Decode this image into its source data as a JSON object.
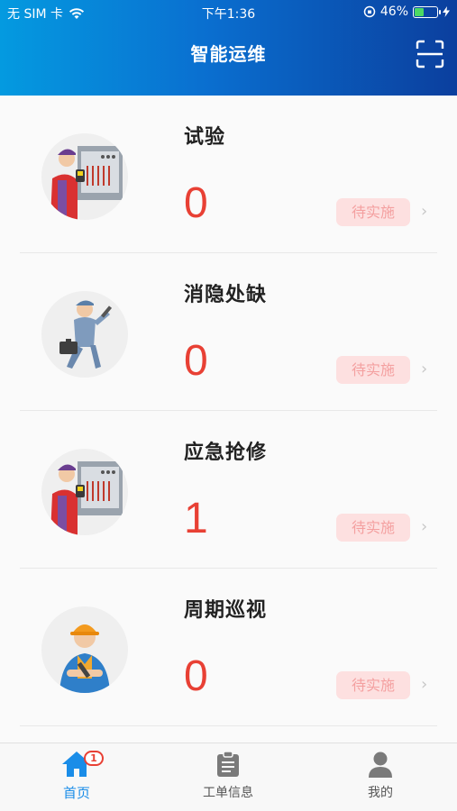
{
  "status_bar": {
    "carrier": "无 SIM 卡",
    "time": "下午1:36",
    "battery_percent": "46%",
    "battery_level": 0.46
  },
  "header": {
    "title": "智能运维",
    "scan_icon": "scan-icon"
  },
  "cards": [
    {
      "title": "试验",
      "count": "0",
      "status": "待实施",
      "avatar_icon": "electrician-icon"
    },
    {
      "title": "消隐处缺",
      "count": "0",
      "status": "待实施",
      "avatar_icon": "repairman-icon"
    },
    {
      "title": "应急抢修",
      "count": "1",
      "status": "待实施",
      "avatar_icon": "electrician-icon"
    },
    {
      "title": "周期巡视",
      "count": "0",
      "status": "待实施",
      "avatar_icon": "worker-icon"
    }
  ],
  "tabbar": {
    "items": [
      {
        "label": "首页",
        "icon": "home-icon",
        "badge": "1",
        "active": true
      },
      {
        "label": "工单信息",
        "icon": "clipboard-icon",
        "active": false
      },
      {
        "label": "我的",
        "icon": "user-icon",
        "active": false
      }
    ]
  },
  "colors": {
    "header_start": "#049ae0",
    "header_end": "#0b3f9e",
    "count": "#e84034",
    "badge_bg": "#fde0e0",
    "badge_text": "#f4a0a0",
    "tab_active": "#1a8de8"
  }
}
